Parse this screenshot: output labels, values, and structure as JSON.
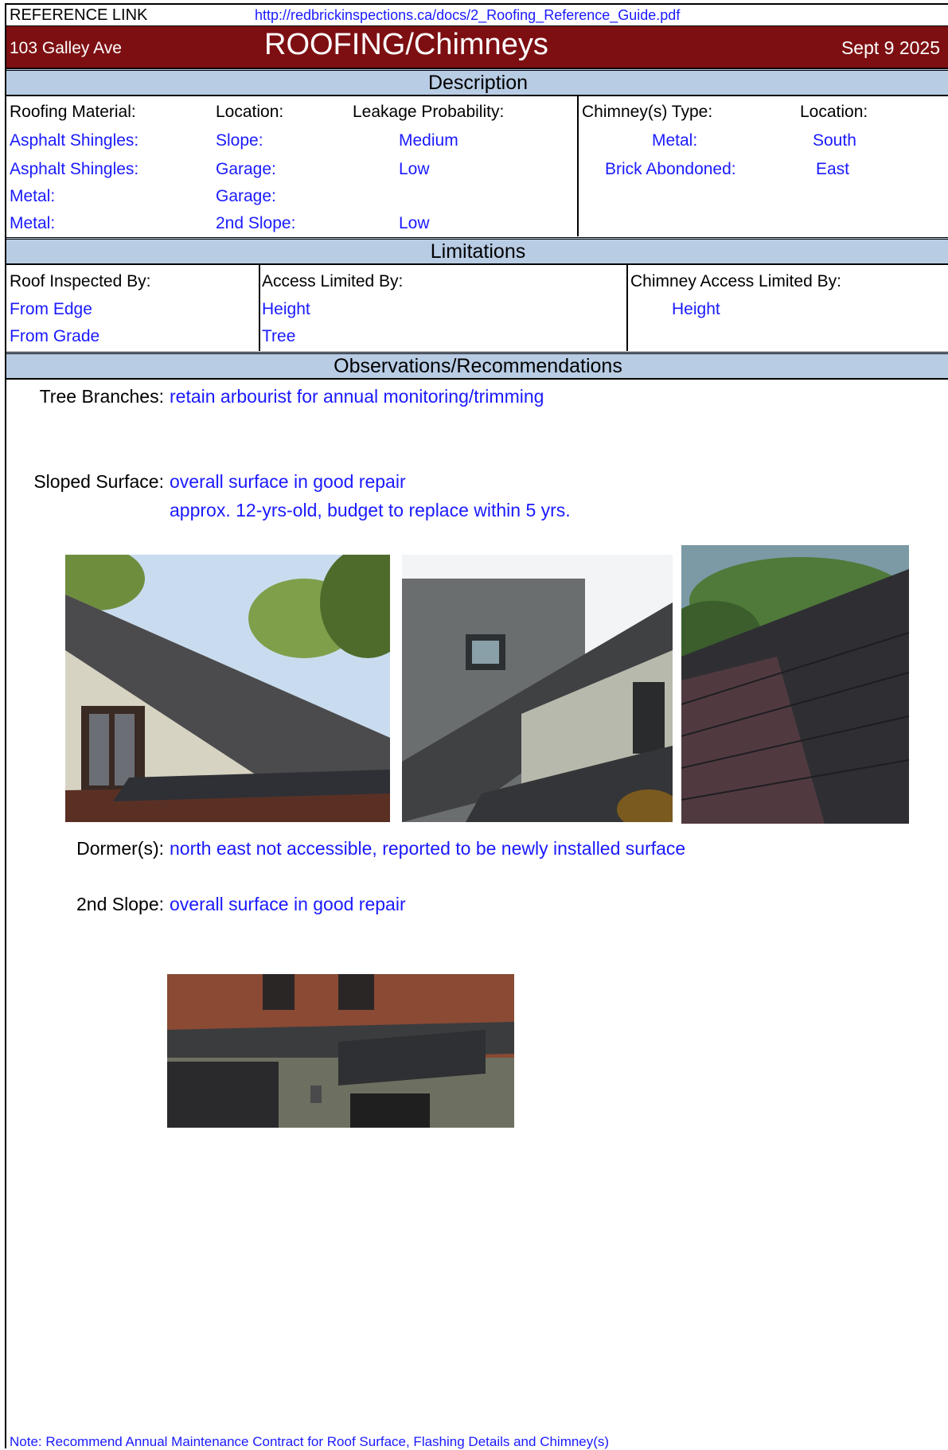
{
  "reference": {
    "label": "REFERENCE LINK",
    "url": "http://redbrickinspections.ca/docs/2_Roofing_Reference_Guide.pdf"
  },
  "header": {
    "address": "103 Galley Ave",
    "title": "ROOFING/Chimneys",
    "date": "Sept 9 2025"
  },
  "description": {
    "title": "Description",
    "col_roofing_material": "Roofing Material:",
    "col_location": "Location:",
    "col_leakage": "Leakage Probability:",
    "col_chimney_type": "Chimney(s) Type:",
    "col_chimney_location": "Location:",
    "roof_rows": [
      {
        "material": "Asphalt Shingles:",
        "location": "Slope:",
        "leakage": "Medium"
      },
      {
        "material": "Asphalt Shingles:",
        "location": "Garage:",
        "leakage": "Low"
      },
      {
        "material": "Metal:",
        "location": "Garage:",
        "leakage": ""
      },
      {
        "material": "Metal:",
        "location": "2nd Slope:",
        "leakage": "Low"
      }
    ],
    "chimney_rows": [
      {
        "type": "Metal:",
        "location": "South"
      },
      {
        "type": "Brick Abondoned:",
        "location": "East"
      }
    ]
  },
  "limitations": {
    "title": "Limitations",
    "col_inspected_by": "Roof Inspected By:",
    "col_access_limited": "Access Limited By:",
    "col_chimney_access": "Chimney Access Limited By:",
    "inspected_by": [
      "From Edge",
      "From Grade"
    ],
    "access_limited": [
      "Height",
      "Tree"
    ],
    "chimney_access": [
      "Height"
    ]
  },
  "observations": {
    "title": "Observations/Recommendations",
    "tree_label": "Tree Branches:",
    "tree_text": "retain arbourist for annual monitoring/trimming",
    "sloped_label": "Sloped Surface:",
    "sloped_text_1": "overall surface in good repair",
    "sloped_text_2": "approx. 12-yrs-old, budget to replace within 5 yrs.",
    "dormer_label": "Dormer(s):",
    "dormer_text": "north east not accessible, reported to be newly installed surface",
    "second_slope_label": "2nd Slope:",
    "second_slope_text": "overall surface in good repair"
  },
  "footer": {
    "note": "Note: Recommend Annual Maintenance Contract for Roof Surface, Flashing Details and Chimney(s)"
  },
  "colors": {
    "header_bg": "#7d0f12",
    "section_bg": "#b8cce4",
    "value_text": "#1a1aff"
  }
}
